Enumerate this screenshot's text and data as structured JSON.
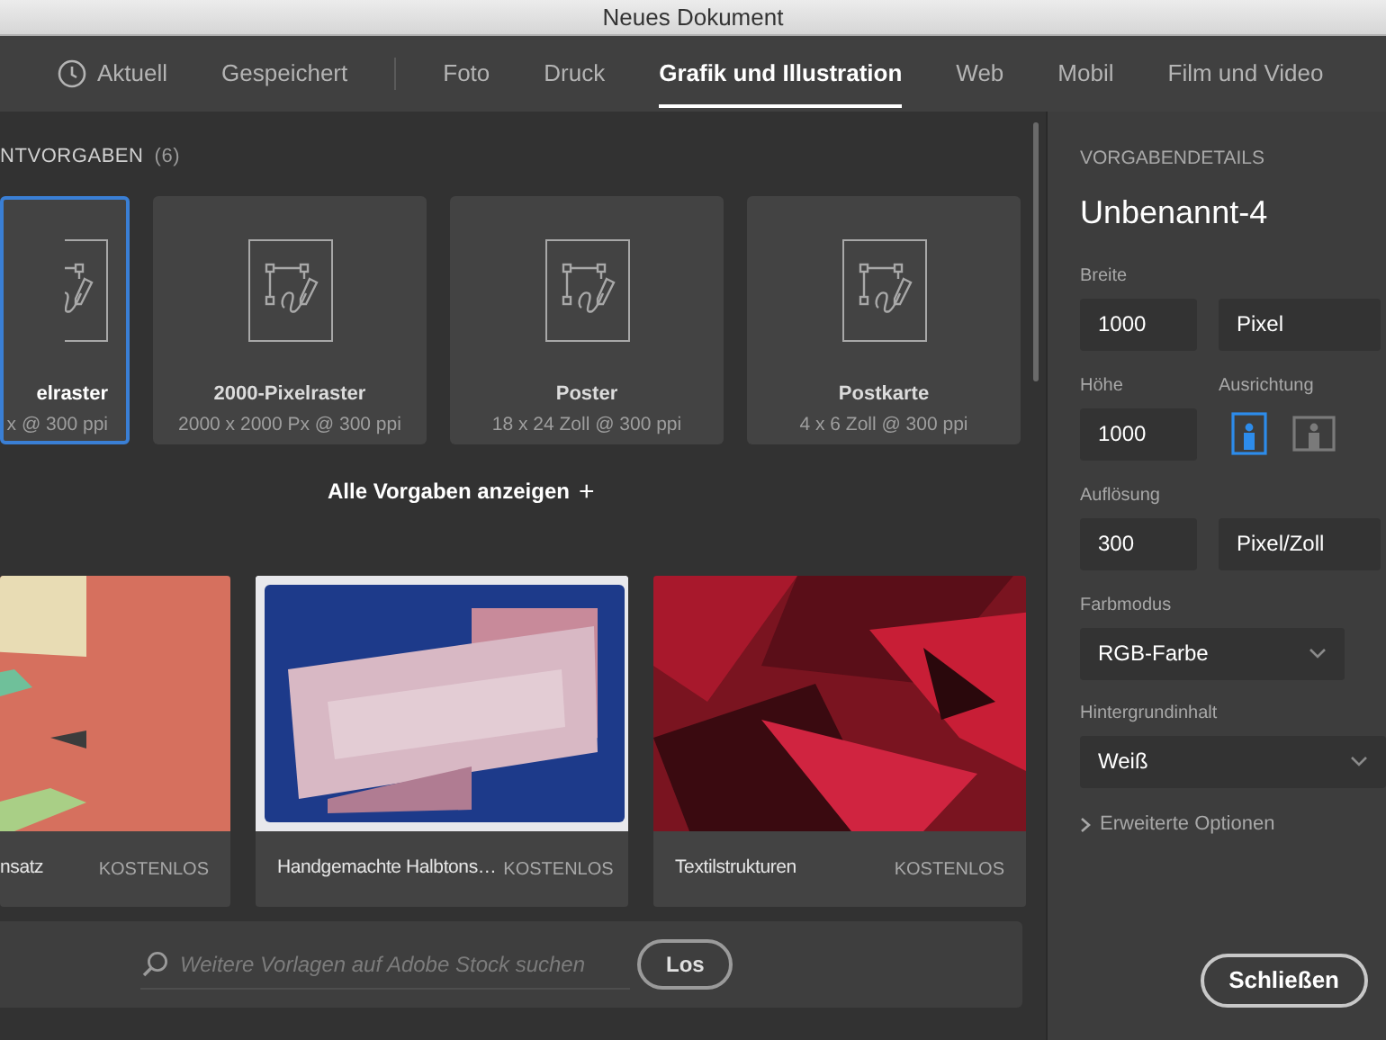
{
  "window": {
    "title": "Neues Dokument"
  },
  "tabs": [
    {
      "label": "Aktuell",
      "kind": "history",
      "selected": false,
      "divider_after": false
    },
    {
      "label": "Gespeichert",
      "kind": "text",
      "selected": false,
      "divider_after": true
    },
    {
      "label": "Foto",
      "kind": "text",
      "selected": false,
      "divider_after": false
    },
    {
      "label": "Druck",
      "kind": "text",
      "selected": false,
      "divider_after": false
    },
    {
      "label": "Grafik und Illustration",
      "kind": "text",
      "selected": true,
      "divider_after": false
    },
    {
      "label": "Web",
      "kind": "text",
      "selected": false,
      "divider_after": false
    },
    {
      "label": "Mobil",
      "kind": "text",
      "selected": false,
      "divider_after": false
    },
    {
      "label": "Film und Video",
      "kind": "text",
      "selected": false,
      "divider_after": false
    }
  ],
  "presets": {
    "heading": "NTVORGABEN",
    "count": "(6)",
    "items": [
      {
        "title": "elraster",
        "size": "x @ 300 ppi",
        "selected": true
      },
      {
        "title": "2000-Pixelraster",
        "size": "2000 x 2000 Px @ 300 ppi",
        "selected": false
      },
      {
        "title": "Poster",
        "size": "18 x 24 Zoll @ 300 ppi",
        "selected": false
      },
      {
        "title": "Postkarte",
        "size": "4 x 6 Zoll @ 300 ppi",
        "selected": false
      }
    ],
    "show_all": "Alle Vorgaben anzeigen",
    "show_all_mark": "+"
  },
  "templates": [
    {
      "title": "nsatz",
      "price": "KOSTENLOS",
      "selected": false
    },
    {
      "title": "Handgemachte Halbtons…",
      "price": "KOSTENLOS",
      "selected": true
    },
    {
      "title": "Textilstrukturen",
      "price": "KOSTENLOS",
      "selected": false
    }
  ],
  "stock_search": {
    "placeholder": "Weitere Vorlagen auf Adobe Stock suchen",
    "button": "Los"
  },
  "details": {
    "heading": "VORGABENDETAILS",
    "name": "Unbenannt-4",
    "width": {
      "label": "Breite",
      "value": "1000",
      "unit": "Pixel"
    },
    "height": {
      "label": "Höhe",
      "value": "1000"
    },
    "orientation": {
      "label": "Ausrichtung",
      "options": [
        {
          "kind": "portrait",
          "selected": true
        },
        {
          "kind": "landscape",
          "selected": false
        }
      ]
    },
    "resolution": {
      "label": "Auflösung",
      "value": "300",
      "unit": "Pixel/Zoll"
    },
    "color_mode": {
      "label": "Farbmodus",
      "value": "RGB-Farbe"
    },
    "background": {
      "label": "Hintergrundinhalt",
      "value": "Weiß"
    },
    "advanced": {
      "label": "Erweiterte Optionen",
      "expanded": false
    }
  },
  "close_button": "Schließen"
}
